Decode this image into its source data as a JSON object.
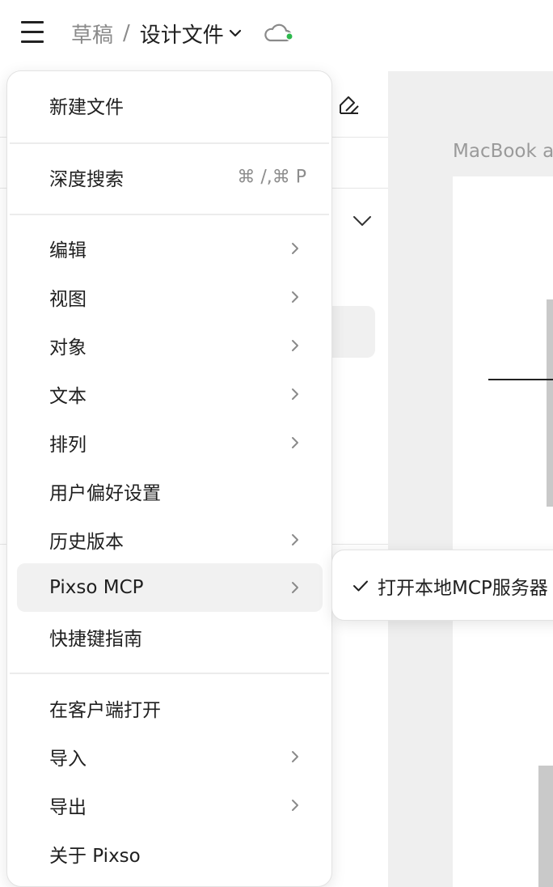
{
  "header": {
    "breadcrumb_drafts": "草稿",
    "breadcrumb_separator": "/",
    "file_name": "设计文件",
    "cloud_status_color": "#2db84d"
  },
  "canvas": {
    "frame_label": "MacBook a"
  },
  "menu": {
    "new_file": "新建文件",
    "deep_search": "深度搜索",
    "deep_search_shortcut": "⌘ /,⌘ P",
    "edit": "编辑",
    "view": "视图",
    "object": "对象",
    "text": "文本",
    "arrange": "排列",
    "preferences": "用户偏好设置",
    "history": "历史版本",
    "pixso_mcp": "Pixso MCP",
    "shortcuts_guide": "快捷键指南",
    "open_in_client": "在客户端打开",
    "import": "导入",
    "export": "导出",
    "about": "关于 Pixso"
  },
  "submenu": {
    "open_local_mcp_server": "打开本地MCP服务器"
  }
}
